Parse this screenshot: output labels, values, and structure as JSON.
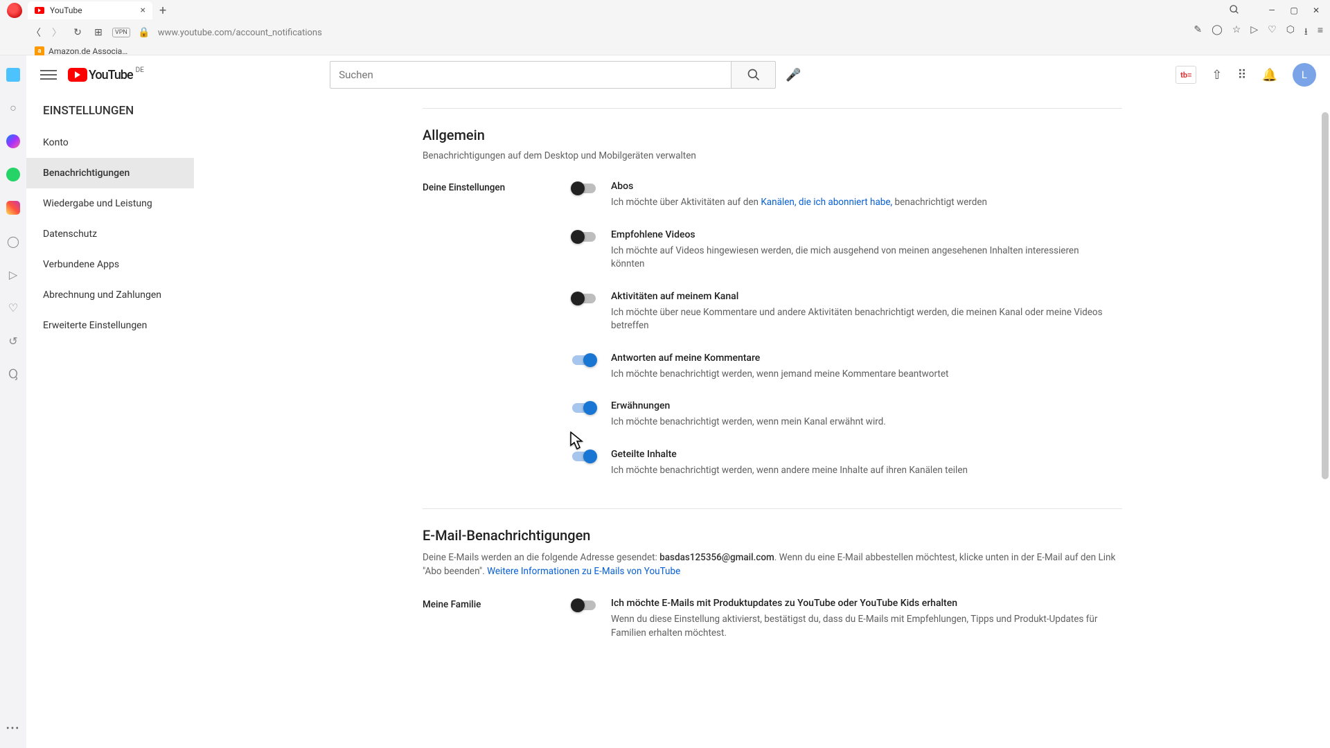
{
  "browser": {
    "tab_title": "YouTube",
    "url": "www.youtube.com/account_notifications",
    "bookmark": "Amazon.de Associa…",
    "vpn": "VPN"
  },
  "yt": {
    "logo_text": "YouTube",
    "country": "DE",
    "search_placeholder": "Suchen",
    "avatar_letter": "L",
    "toolbar_badge": "tb"
  },
  "sidebar": {
    "title": "EINSTELLUNGEN",
    "items": [
      {
        "label": "Konto"
      },
      {
        "label": "Benachrichtigungen"
      },
      {
        "label": "Wiedergabe und Leistung"
      },
      {
        "label": "Datenschutz"
      },
      {
        "label": "Verbundene Apps"
      },
      {
        "label": "Abrechnung und Zahlungen"
      },
      {
        "label": "Erweiterte Einstellungen"
      }
    ]
  },
  "general": {
    "title": "Allgemein",
    "subtitle": "Benachrichtigungen auf dem Desktop und Mobilgeräten verwalten",
    "row_label": "Deine Einstellungen",
    "items": [
      {
        "title": "Abos",
        "desc_before": "Ich möchte über Aktivitäten auf den ",
        "link": "Kanälen, die ich abonniert habe,",
        "desc_after": " benachrichtigt werden",
        "on": false
      },
      {
        "title": "Empfohlene Videos",
        "desc": "Ich möchte auf Videos hingewiesen werden, die mich ausgehend von meinen angesehenen Inhalten interessieren könnten",
        "on": false
      },
      {
        "title": "Aktivitäten auf meinem Kanal",
        "desc": "Ich möchte über neue Kommentare und andere Aktivitäten benachrichtigt werden, die meinen Kanal oder meine Videos betreffen",
        "on": false
      },
      {
        "title": "Antworten auf meine Kommentare",
        "desc": "Ich möchte benachrichtigt werden, wenn jemand meine Kommentare beantwortet",
        "on": true
      },
      {
        "title": "Erwähnungen",
        "desc": "Ich möchte benachrichtigt werden, wenn mein Kanal erwähnt wird.",
        "on": true
      },
      {
        "title": "Geteilte Inhalte",
        "desc": "Ich möchte benachrichtigt werden, wenn andere meine Inhalte auf ihren Kanälen teilen",
        "on": true
      }
    ]
  },
  "email": {
    "title": "E-Mail-Benachrichtigungen",
    "intro_before": "Deine E-Mails werden an die folgende Adresse gesendet: ",
    "address": "basdas125356@gmail.com",
    "intro_after": ". Wenn du eine E-Mail abbestellen möchtest, klicke unten in der E-Mail auf den Link \"Abo beenden\". ",
    "link": "Weitere Informationen zu E-Mails von YouTube",
    "row_label": "Meine Familie",
    "item": {
      "title": "Ich möchte E-Mails mit Produktupdates zu YouTube oder YouTube Kids erhalten",
      "desc": "Wenn du diese Einstellung aktivierst, bestätigst du, dass du E-Mails mit Empfehlungen, Tipps und Produkt-Updates für Familien erhalten möchtest.",
      "on": false
    }
  }
}
